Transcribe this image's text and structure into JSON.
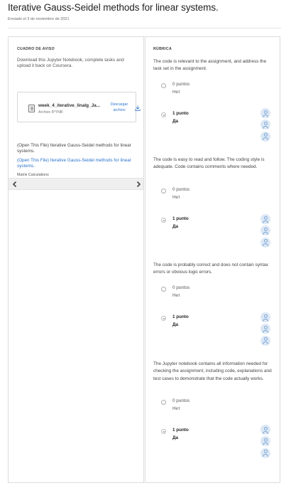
{
  "header": {
    "title": "Iterative Gauss-Seidel methods for linear systems.",
    "subtitle": "Enviado el 3 de noviembre de 2021"
  },
  "left_panel": {
    "section_label": "CUADRO DE AVISO",
    "instructions": "Download this Jupyter Notebook, complete tasks and upload it back on Coursera.",
    "file": {
      "name": "week_4_iterative_linalg_Ja...",
      "type": "Archivo IPYNB",
      "download_label": "Descargar archivo",
      "file_icon": "document-icon",
      "download_icon": "download-icon"
    },
    "open_file_text": "(Open This File) Iterative Gauss-Seidel methods for linear systems.",
    "open_file_link": "(Open This File) Iterative Gauss-Seidel methods for linear systems.",
    "matrix_label": "Matrix Calculations",
    "nav": {
      "prev_icon": "chevron-left-icon",
      "next_icon": "chevron-right-icon"
    }
  },
  "right_panel": {
    "section_label": "RÚBRICA",
    "criteria": [
      {
        "text": "The code is relevant to the assignment, and address the task set in the assignment.",
        "options": [
          {
            "points": "0 puntos",
            "label": "Нет"
          },
          {
            "points": "1 punto",
            "label": "Да"
          }
        ]
      },
      {
        "text": "The code is easy to read and follow. The coding style is adequate. Code contains comments where needed.",
        "options": [
          {
            "points": "0 puntos",
            "label": "Нет"
          },
          {
            "points": "1 punto",
            "label": "Да"
          }
        ]
      },
      {
        "text": "The code is probably correct and does not contain syntax errors or obvious logic errors.",
        "options": [
          {
            "points": "0 puntos",
            "label": "Нет"
          },
          {
            "points": "1 punto",
            "label": "Да"
          }
        ]
      },
      {
        "text": "The Jupyter notebook contains all information needed for checking the assignment, including code, explanations and test cases to demonstrate that the code actually works.",
        "options": [
          {
            "points": "0 puntos",
            "label": "Нет"
          },
          {
            "points": "1 punto",
            "label": "Да"
          }
        ]
      }
    ],
    "avatar_icon": "user-avatar-icon"
  },
  "colors": {
    "link": "#2a73cc",
    "avatar_bg": "#dde8f5",
    "avatar_stroke": "#7fa8d6"
  }
}
